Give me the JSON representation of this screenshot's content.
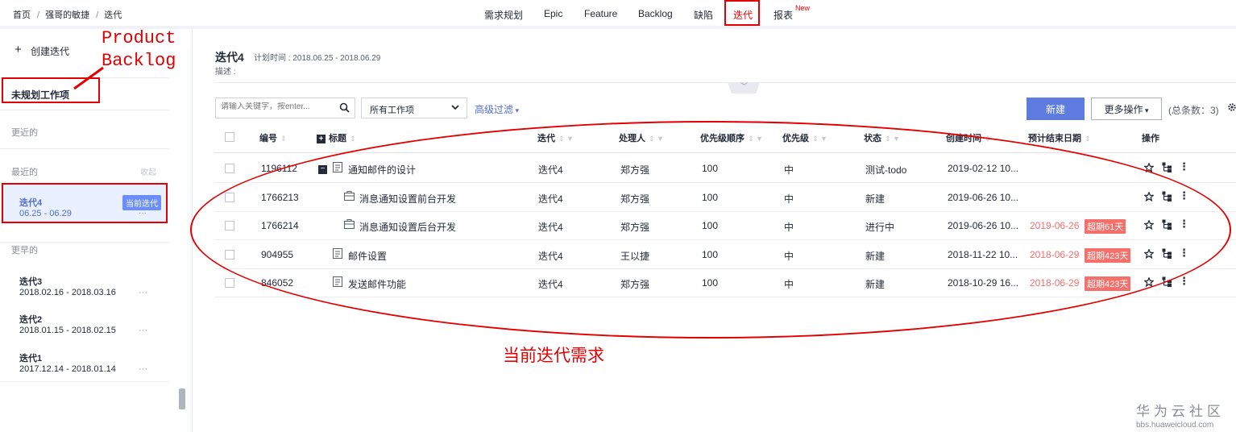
{
  "breadcrumb": [
    "首页",
    "强哥的敏捷",
    "迭代"
  ],
  "topnav": {
    "items": [
      "需求规划",
      "Epic",
      "Feature",
      "Backlog",
      "缺陷",
      "迭代",
      "报表"
    ],
    "active": "迭代",
    "new_badge": "New"
  },
  "sidebar": {
    "create_label": "创建迭代",
    "unplanned_label": "未规划工作项",
    "recent_label": "更近的",
    "latest_label": "最近的",
    "collapse_label": "收起",
    "current_iteration": {
      "name": "迭代4",
      "range": "06.25 - 06.29",
      "badge": "当前迭代",
      "more": "···"
    },
    "earlier_label": "更早的",
    "earlier_iterations": [
      {
        "name": "迭代3",
        "range": "2018.02.16 - 2018.03.16",
        "more": "···"
      },
      {
        "name": "迭代2",
        "range": "2018.01.15 - 2018.02.15",
        "more": "···"
      },
      {
        "name": "迭代1",
        "range": "2017.12.14 - 2018.01.14",
        "more": "···"
      }
    ]
  },
  "header": {
    "title": "迭代4",
    "plan": "计划时间 : 2018.06.25 - 2018.06.29",
    "desc": "描述 :"
  },
  "toolbar": {
    "search_placeholder": "请输入关键字，按enter...",
    "type_select": "所有工作项",
    "advanced_filter": "高级过滤",
    "new_button": "新建",
    "more_button": "更多操作",
    "total": "(总条数：3)"
  },
  "table": {
    "columns": [
      "编号",
      "标题",
      "迭代",
      "处理人",
      "优先级顺序",
      "优先级",
      "状态",
      "创建时间",
      "预计结束日期",
      "操作"
    ],
    "rows": [
      {
        "id": "1196112",
        "title": "通知邮件的设计",
        "iteration": "迭代4",
        "owner": "郑方强",
        "order": "100",
        "priority": "中",
        "status": "测试-todo",
        "created": "2019-02-12 10...",
        "due": "",
        "overdue": ""
      },
      {
        "id": "1766213",
        "title": "消息通知设置前台开发",
        "iteration": "迭代4",
        "owner": "郑方强",
        "order": "100",
        "priority": "中",
        "status": "新建",
        "created": "2019-06-26 10...",
        "due": "",
        "overdue": ""
      },
      {
        "id": "1766214",
        "title": "消息通知设置后台开发",
        "iteration": "迭代4",
        "owner": "郑方强",
        "order": "100",
        "priority": "中",
        "status": "进行中",
        "created": "2019-06-26 10...",
        "due": "2019-06-26",
        "overdue": "超期61天"
      },
      {
        "id": "904955",
        "title": "邮件设置",
        "iteration": "迭代4",
        "owner": "王以捷",
        "order": "100",
        "priority": "中",
        "status": "新建",
        "created": "2018-11-22 10...",
        "due": "2018-06-29",
        "overdue": "超期423天"
      },
      {
        "id": "846052",
        "title": "发送邮件功能",
        "iteration": "迭代4",
        "owner": "郑方强",
        "order": "100",
        "priority": "中",
        "status": "新建",
        "created": "2018-10-29 16...",
        "due": "2018-06-29",
        "overdue": "超期423天"
      }
    ]
  },
  "annotations": {
    "product_backlog": [
      "Product",
      "Backlog"
    ],
    "current_requirements": "当前迭代需求"
  },
  "watermark": {
    "title": "华为云社区",
    "url": "bbs.huaweicloud.com"
  },
  "colors": {
    "accent": "#5e7ce0",
    "annotation": "#e30000",
    "overdue": "#f66f6a",
    "current_badge": "#6b8dff"
  }
}
